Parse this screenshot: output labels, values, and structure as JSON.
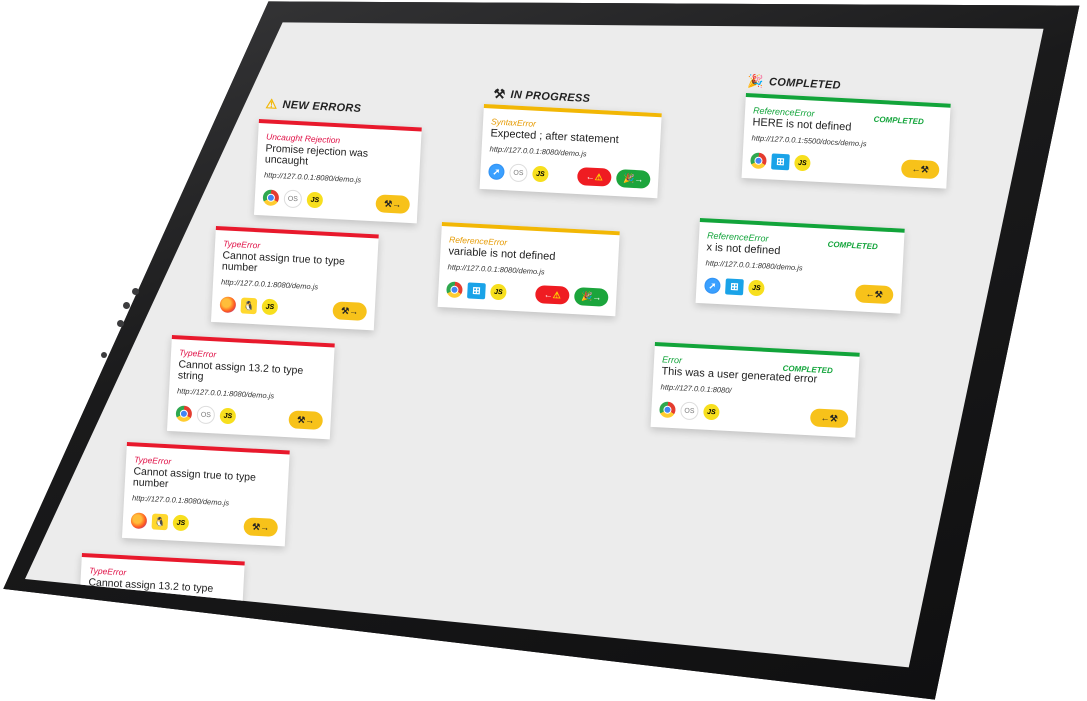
{
  "columns": {
    "new": {
      "title": "NEW ERRORS",
      "icon": "⚠"
    },
    "progress": {
      "title": "IN PROGRESS",
      "icon": "⚒"
    },
    "completed": {
      "title": "COMPLETED",
      "icon": "🎉"
    }
  },
  "new_cards": [
    {
      "type": "Uncaught Rejection",
      "message": "Promise rejection was uncaught",
      "url": "http://127.0.0.1:8080/demo.js",
      "browser": "chrome-icon",
      "os": "macos-icon",
      "lang": "JS"
    },
    {
      "type": "TypeError",
      "message": "Cannot assign true to type number",
      "url": "http://127.0.0.1:8080/demo.js",
      "browser": "firefox-icon",
      "os": "linux-icon",
      "lang": "JS"
    },
    {
      "type": "TypeError",
      "message": "Cannot assign 13.2 to type string",
      "url": "http://127.0.0.1:8080/demo.js",
      "browser": "chrome-icon",
      "os": "macos-icon",
      "lang": "JS"
    },
    {
      "type": "TypeError",
      "message": "Cannot assign true to type number",
      "url": "http://127.0.0.1:8080/demo.js",
      "browser": "firefox-icon",
      "os": "linux-icon",
      "lang": "JS"
    },
    {
      "type": "TypeError",
      "message": "Cannot assign 13.2 to type",
      "url": "",
      "browser": "",
      "os": "",
      "lang": ""
    }
  ],
  "progress_cards": [
    {
      "type": "SyntaxError",
      "message": "Expected ; after statement",
      "url": "http://127.0.0.1:8080/demo.js",
      "browser": "safari-icon",
      "os": "macos-icon",
      "lang": "JS"
    },
    {
      "type": "ReferenceError",
      "message": "variable is not defined",
      "url": "http://127.0.0.1:8080/demo.js",
      "browser": "chrome-icon",
      "os": "windows-icon",
      "lang": "JS"
    }
  ],
  "completed_cards": [
    {
      "type": "ReferenceError",
      "badge": "COMPLETED",
      "message": "HERE is not defined",
      "url": "http://127.0.0.1:5500/docs/demo.js",
      "browser": "chrome-icon",
      "os": "windows-icon",
      "lang": "JS"
    },
    {
      "type": "ReferenceError",
      "badge": "COMPLETED",
      "message": "x is not defined",
      "url": "http://127.0.0.1:8080/demo.js",
      "browser": "safari-icon",
      "os": "windows-icon",
      "lang": "JS"
    },
    {
      "type": "Error",
      "badge": "COMPLETED",
      "message": "This was a user generated error",
      "url": "http://127.0.0.1:8080/",
      "browser": "chrome-icon",
      "os": "macos-icon",
      "lang": "JS"
    }
  ],
  "labels": {
    "macos": "OS",
    "forward_arrow": "→",
    "back_arrow": "←",
    "tools": "⚒",
    "warning": "⚠",
    "party": "🎉"
  },
  "colors": {
    "new": "#e8192c",
    "progress": "#f2b705",
    "completed": "#12a43a",
    "button_yellow": "#f7c21a",
    "button_red": "#ef1c22",
    "button_green": "#1ca53c"
  }
}
